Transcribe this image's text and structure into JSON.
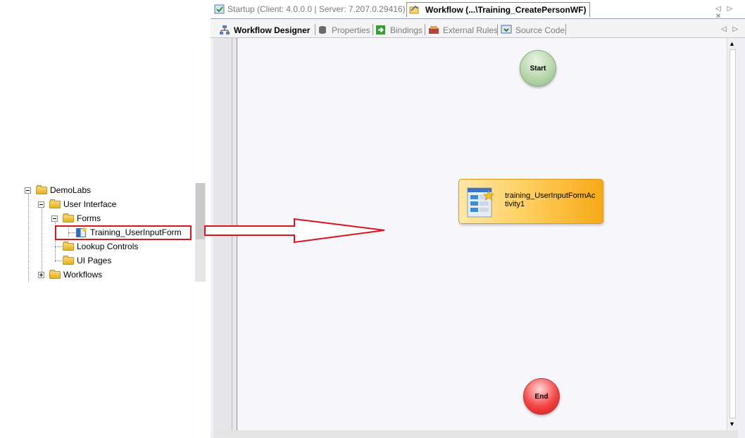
{
  "tree": {
    "items": [
      {
        "label": "DemoLabs"
      },
      {
        "label": "User Interface"
      },
      {
        "label": "Forms"
      },
      {
        "label": "Training_UserInputForm"
      },
      {
        "label": "Lookup Controls"
      },
      {
        "label": "UI Pages"
      },
      {
        "label": "Workflows"
      }
    ]
  },
  "doc_tabs": {
    "startup": "Startup (Client: 4.0.0.0 | Server: 7.207.0.29416)",
    "workflow": "Workflow (...\\Training_CreatePersonWF)"
  },
  "sub_tabs": {
    "designer": "Workflow Designer",
    "properties": "Properties",
    "bindings": "Bindings",
    "external_rules": "External Rules",
    "source_code": "Source Code"
  },
  "canvas": {
    "start": "Start",
    "end": "End",
    "activity": "training_UserInputFormActivity1"
  },
  "colors": {
    "annotation": "#d9141e",
    "start": "#b7d7ac",
    "end": "#f24646",
    "activity": "#ffd062"
  }
}
